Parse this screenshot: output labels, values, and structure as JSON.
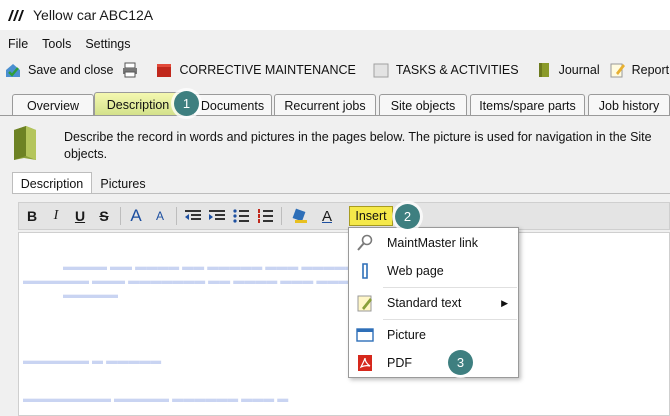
{
  "window": {
    "title": "Yellow car ABC12A"
  },
  "menubar": {
    "items": [
      "File",
      "Tools",
      "Settings"
    ]
  },
  "toolbar": {
    "save_close": "Save and close",
    "corrective": "CORRECTIVE MAINTENANCE",
    "tasks": "TASKS & ACTIVITIES",
    "journal": "Journal",
    "report": "Report"
  },
  "tabs": [
    "Overview",
    "Description",
    "Documents",
    "Recurrent jobs",
    "Site objects",
    "Items/spare parts",
    "Job history"
  ],
  "active_tab": "Description",
  "description": {
    "text": "Describe the record in words and pictures in the pages below. The picture is used for navigation in the Site objects."
  },
  "subtabs": [
    "Description",
    "Pictures"
  ],
  "editor": {
    "bold": "B",
    "italic": "I",
    "underline": "U",
    "strike": "S",
    "font_grow": "A",
    "font_shrink": "A",
    "font_color": "A",
    "insert_label": "Insert"
  },
  "insert_menu": {
    "items": [
      {
        "label": "MaintMaster link",
        "icon": "magnifier-icon"
      },
      {
        "label": "Web page",
        "icon": "paperclip-icon"
      },
      {
        "label": "Standard text",
        "icon": "notepad-icon",
        "submenu": true
      },
      {
        "label": "Picture",
        "icon": "picture-icon"
      },
      {
        "label": "PDF",
        "icon": "pdf-icon"
      }
    ],
    "submenu_arrow": "▶"
  },
  "badges": [
    "1",
    "2",
    "3"
  ],
  "colors": {
    "active_tab": "#dce68f",
    "insert_button": "#f5e94a",
    "badge": "#3e7f80"
  }
}
